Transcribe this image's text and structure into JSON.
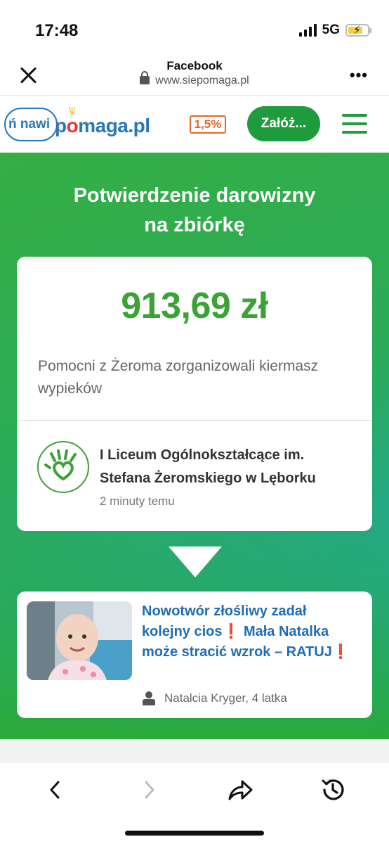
{
  "status_bar": {
    "time": "17:48",
    "network": "5G"
  },
  "browser": {
    "title": "Facebook",
    "url": "www.siepomaga.pl"
  },
  "site_header": {
    "logo_bubble_text": "ń nawi",
    "logo_text_pre": "p",
    "logo_text_o": "o",
    "logo_text_post": "maga.pl",
    "tax_badge": "1,5%",
    "cta_label": "Załóż..."
  },
  "hero": {
    "title_line1": "Potwierdzenie darowizny",
    "title_line2": "na zbiórkę"
  },
  "donation": {
    "amount": "913,69 zł",
    "description": "Pomocni z Żeroma zorganizowali kiermasz wypieków",
    "organization": "I Liceum Ogólnokształcące im. Stefana Żeromskiego w Lęborku",
    "time_ago": "2 minuty temu"
  },
  "fundraiser": {
    "title_part1": "Nowotwór złośliwy zadał kolejny cios",
    "title_part2": " Mała Natalka może stracić wzrok – RATUJ",
    "exclamation": "❗",
    "beneficiary": "Natalcia Kryger, 4 latka"
  },
  "colors": {
    "brand_green": "#1e9b3d",
    "amount_green": "#3ba235",
    "link_blue": "#1f6cb5",
    "tax_orange": "#e5672c"
  },
  "icons": [
    "close-icon",
    "lock-icon",
    "more-icon",
    "menu-icon",
    "hand-heart-icon",
    "person-icon",
    "back-icon",
    "forward-icon",
    "share-icon",
    "history-icon"
  ]
}
